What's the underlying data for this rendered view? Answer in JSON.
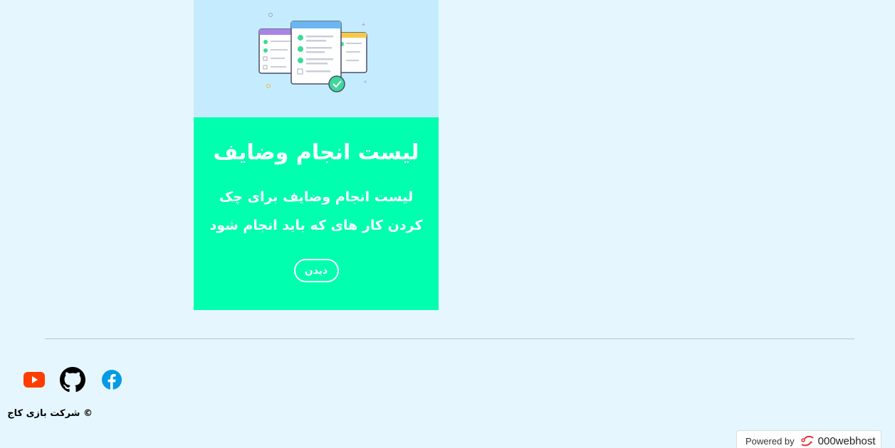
{
  "card": {
    "title": "لیست انجام وضایف",
    "description": "لیست انجام وضایف برای چک کردن کار های که باید انجام شود",
    "button_label": "دیدن",
    "image_icon": "checklist-illustration",
    "colors": {
      "image_bg": "#c5ecfe",
      "body_bg": "#00ffae",
      "text": "#ffffff"
    }
  },
  "footer": {
    "social": [
      {
        "name": "youtube",
        "icon": "youtube-icon",
        "color": "#ff3d00"
      },
      {
        "name": "github",
        "icon": "github-icon",
        "color": "#000000"
      },
      {
        "name": "facebook",
        "icon": "facebook-icon",
        "color": "#039be5"
      }
    ],
    "copyright": "© شرکت بازی کاج"
  },
  "host_badge": {
    "label": "Powered by",
    "brand": "000webhost",
    "icon": "000webhost-logo-icon"
  },
  "page_bg": "#e6f6ff"
}
